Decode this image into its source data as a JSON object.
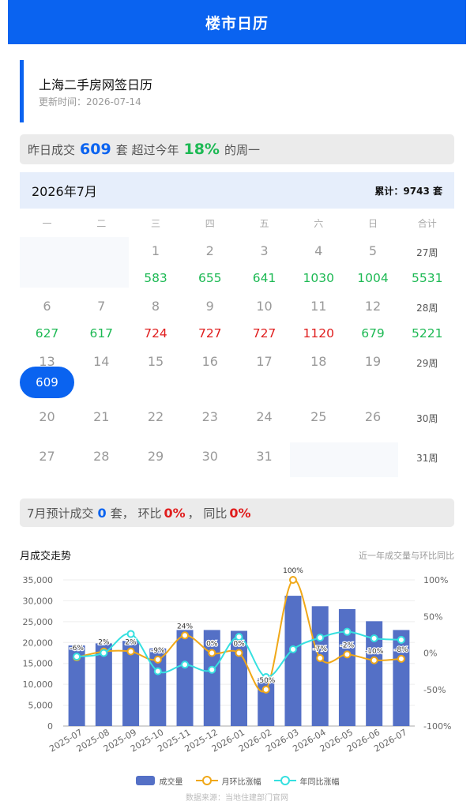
{
  "header": {
    "title": "楼市日历"
  },
  "title_card": {
    "title": "上海二手房网签日历",
    "updated": "更新时间：2026-07-14"
  },
  "summary": {
    "prefix": "昨日成交",
    "count": "609",
    "unit": "套 超过今年",
    "percent": "18%",
    "suffix": "的周一"
  },
  "calendar": {
    "month": "2026年7月",
    "total": "累计：9743 套",
    "weekdays": [
      "一",
      "二",
      "三",
      "四",
      "五",
      "六",
      "日",
      "合计"
    ],
    "weeks": [
      {
        "days": [
          "",
          "",
          "1",
          "2",
          "3",
          "4",
          "5"
        ],
        "values": [
          "",
          "",
          "583",
          "655",
          "641",
          "1030",
          "1004"
        ],
        "colors": [
          "",
          "",
          "g",
          "g",
          "g",
          "g",
          "g"
        ],
        "week_label": "27周",
        "week_total": "5531"
      },
      {
        "days": [
          "6",
          "7",
          "8",
          "9",
          "10",
          "11",
          "12"
        ],
        "values": [
          "627",
          "617",
          "724",
          "727",
          "727",
          "1120",
          "679"
        ],
        "colors": [
          "g",
          "g",
          "r",
          "r",
          "r",
          "r",
          "g"
        ],
        "week_label": "28周",
        "week_total": "5221"
      },
      {
        "days": [
          "13",
          "14",
          "15",
          "16",
          "17",
          "18",
          "19"
        ],
        "values": [
          "609",
          "",
          "",
          "",
          "",
          "",
          ""
        ],
        "colors": [
          "sel",
          "",
          "",
          "",
          "",
          "",
          ""
        ],
        "week_label": "29周",
        "week_total": ""
      },
      {
        "days": [
          "20",
          "21",
          "22",
          "23",
          "24",
          "25",
          "26"
        ],
        "values": [
          "",
          "",
          "",
          "",
          "",
          "",
          ""
        ],
        "colors": [
          "",
          "",
          "",
          "",
          "",
          "",
          ""
        ],
        "week_label": "30周",
        "week_total": ""
      },
      {
        "days": [
          "27",
          "28",
          "29",
          "30",
          "31",
          "",
          ""
        ],
        "values": [
          "",
          "",
          "",
          "",
          "",
          "",
          ""
        ],
        "colors": [
          "",
          "",
          "",
          "",
          "",
          "",
          ""
        ],
        "week_label": "31周",
        "week_total": ""
      }
    ]
  },
  "forecast": {
    "prefix": "7月预计成交",
    "count": "0",
    "unit": "套， 环比",
    "mom": "0%",
    "sep": "， 同比",
    "yoy": "0%"
  },
  "trend": {
    "title": "月成交走势",
    "subtitle": "近一年成交量与环比同比"
  },
  "colors": {
    "accent": "#0a63f0",
    "bar": "#5470c6",
    "mom_line": "#f0a818",
    "yoy_line": "#36e0e0"
  },
  "chart_data": {
    "type": "bar",
    "categories": [
      "2025-07",
      "2025-08",
      "2025-09",
      "2025-10",
      "2025-11",
      "2025-12",
      "2026-01",
      "2026-02",
      "2026-03",
      "2026-04",
      "2026-05",
      "2026-06",
      "2026-07"
    ],
    "series": [
      {
        "name": "成交量",
        "type": "bar",
        "axis": "left",
        "values": [
          19300,
          19800,
          20400,
          18600,
          23000,
          23000,
          22800,
          11400,
          31200,
          28700,
          28000,
          25100,
          23000
        ]
      },
      {
        "name": "月环比涨幅",
        "type": "line",
        "axis": "right",
        "values": [
          -6,
          2,
          2,
          -9,
          24,
          0,
          0,
          -50,
          100,
          -7,
          -2,
          -10,
          -8
        ],
        "labels": [
          "-6%",
          "2%",
          "2%",
          "-9%",
          "24%",
          "0%",
          "0%",
          "-50%",
          "100%",
          "-7%",
          "-2%",
          "-10%",
          "-8%"
        ]
      },
      {
        "name": "年同比涨幅",
        "type": "line",
        "axis": "right",
        "values": [
          -5,
          0,
          26,
          -25,
          -16,
          -23,
          22,
          -33,
          5,
          21,
          29,
          20,
          18
        ]
      }
    ],
    "left_axis": {
      "min": 0,
      "max": 35000,
      "ticks": [
        "0",
        "5,000",
        "10,000",
        "15,000",
        "20,000",
        "25,000",
        "30,000",
        "35,000"
      ]
    },
    "right_axis": {
      "min": -100,
      "max": 100,
      "ticks": [
        "-100%",
        "-50%",
        "0%",
        "50%",
        "100%"
      ]
    },
    "grid": true,
    "legend": "bottom"
  },
  "legend": {
    "bar": "成交量",
    "mom": "月环比涨幅",
    "yoy": "年同比涨幅"
  },
  "source": "数据来源：当地住建部门官网"
}
